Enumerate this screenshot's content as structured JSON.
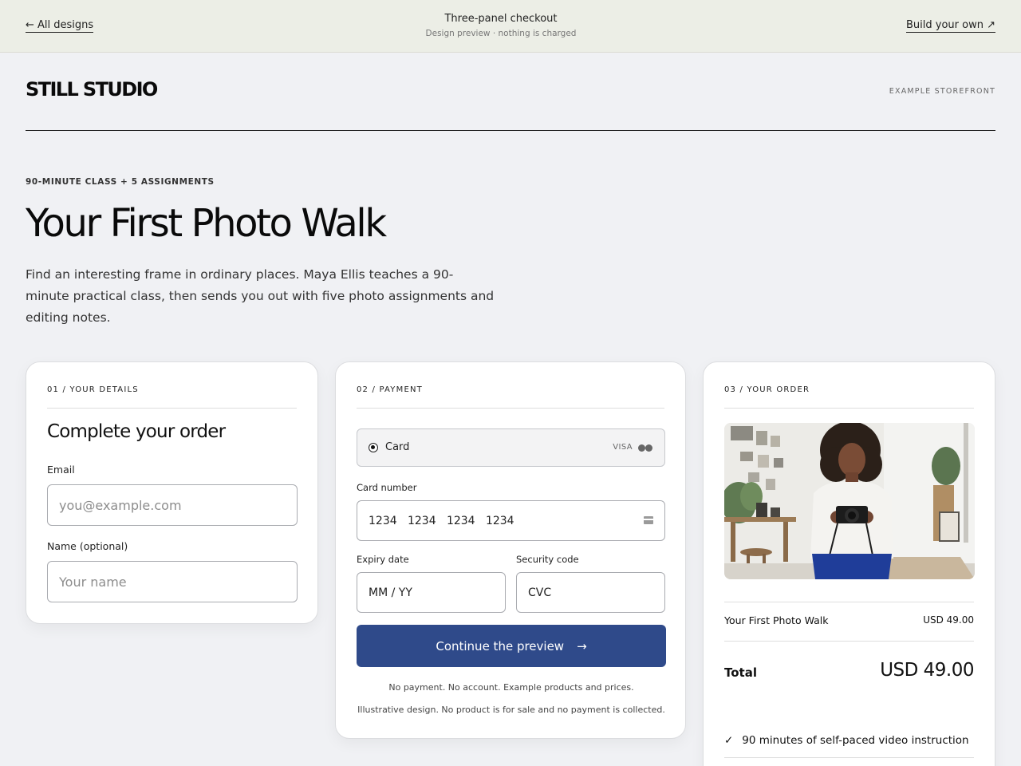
{
  "topbar": {
    "back_link": "← All designs",
    "title": "Three-panel checkout",
    "subtitle": "Design preview · nothing is charged",
    "build_link": "Build your own ↗"
  },
  "header": {
    "brand": "STILL STUDIO",
    "tag": "EXAMPLE STOREFRONT"
  },
  "hero": {
    "eyebrow": "90-MINUTE CLASS + 5 ASSIGNMENTS",
    "title": "Your First Photo Walk",
    "description": "Find an interesting frame in ordinary places. Maya Ellis teaches a 90-minute practical class, then sends you out with five photo assignments and editing notes."
  },
  "details": {
    "label": "01 / YOUR DETAILS",
    "heading": "Complete your order",
    "email_label": "Email",
    "email_placeholder": "you@example.com",
    "name_label": "Name (optional)",
    "name_placeholder": "Your name"
  },
  "payment": {
    "label": "02 / PAYMENT",
    "method_label": "Card",
    "visa": "VISA",
    "card_number_label": "Card number",
    "card_number_placeholder": "1234   1234   1234   1234",
    "expiry_label": "Expiry date",
    "expiry_placeholder": "MM / YY",
    "cvc_label": "Security code",
    "cvc_placeholder": "CVC",
    "cta": "Continue the preview",
    "cta_arrow": "→",
    "note1": "No payment. No account. Example products and prices.",
    "note2": "Illustrative design. No product is for sale and no payment is collected."
  },
  "order": {
    "label": "03 / YOUR ORDER",
    "item_name": "Your First Photo Walk",
    "item_price": "USD 49.00",
    "total_label": "Total",
    "total_value": "USD 49.00",
    "feature_check": "✓",
    "feature_1": "90 minutes of self-paced video instruction"
  },
  "colors": {
    "accent": "#2f4a8a",
    "topbar_bg": "#eceee6",
    "page_bg": "#f0f1f4"
  }
}
